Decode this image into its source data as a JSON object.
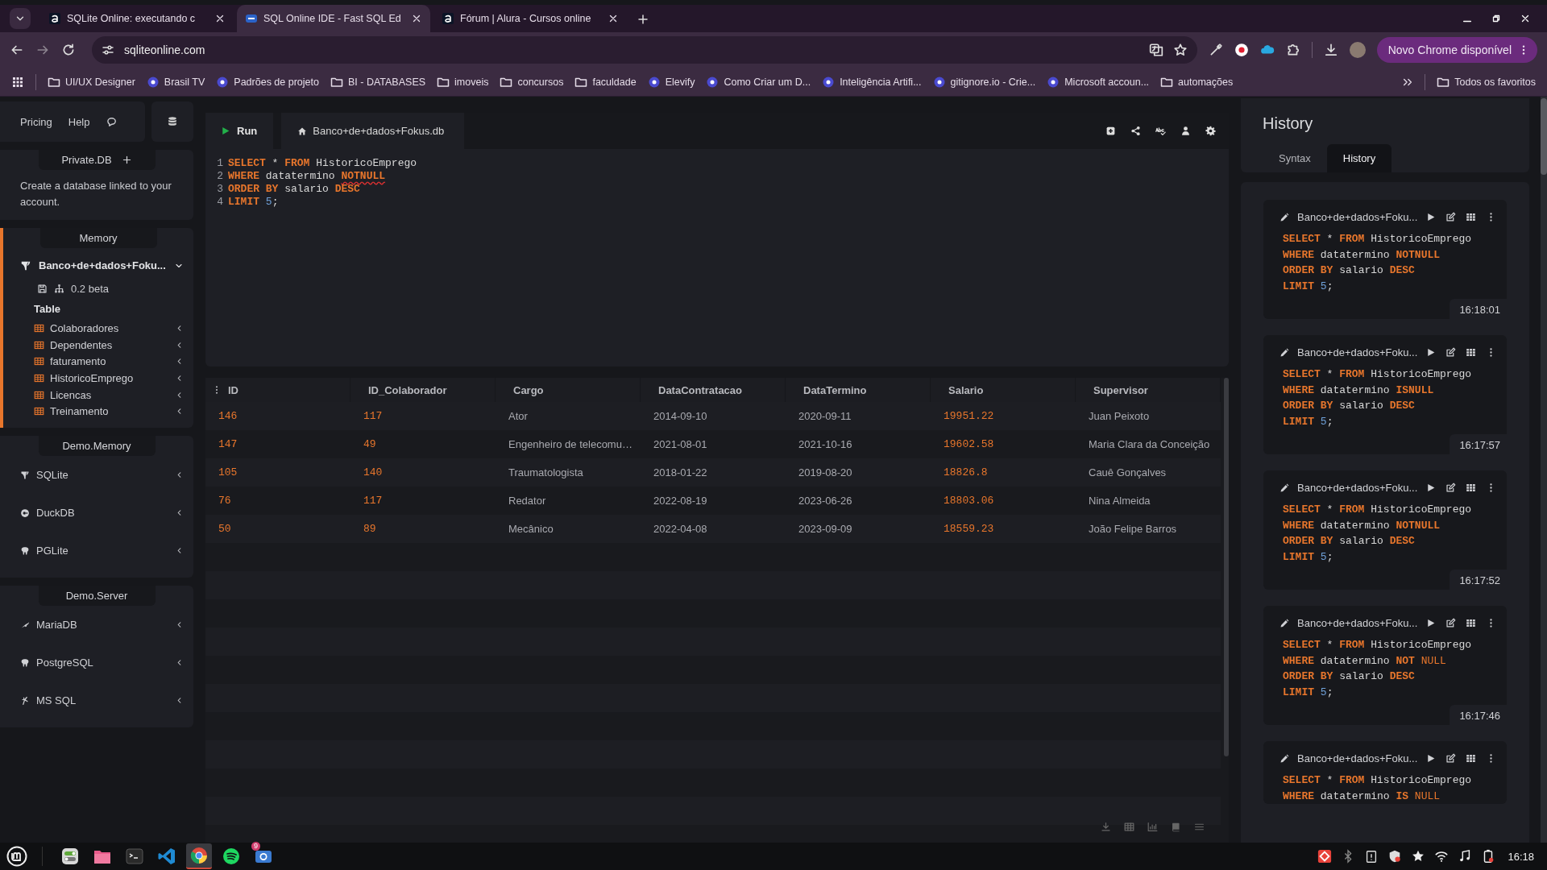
{
  "browser": {
    "tabs": [
      {
        "title": "SQLite Online: executando c",
        "kind": "alura",
        "selected": false
      },
      {
        "title": "SQL Online IDE - Fast SQL Ed",
        "kind": "sql",
        "selected": true
      },
      {
        "title": "Fórum | Alura - Cursos online",
        "kind": "alura",
        "selected": false
      }
    ],
    "address": "sqliteonline.com",
    "update_button": "Novo Chrome disponível",
    "bookmarks": [
      {
        "label": "UI/UX Designer",
        "kind": "folder"
      },
      {
        "label": "Brasil TV",
        "kind": "site"
      },
      {
        "label": "Padrões de projeto",
        "kind": "site"
      },
      {
        "label": "BI - DATABASES",
        "kind": "folder"
      },
      {
        "label": "imoveis",
        "kind": "folder"
      },
      {
        "label": "concursos",
        "kind": "folder"
      },
      {
        "label": "faculdade",
        "kind": "folder"
      },
      {
        "label": "Elevify",
        "kind": "site"
      },
      {
        "label": "Como Criar um D...",
        "kind": "site"
      },
      {
        "label": "Inteligência Artifi...",
        "kind": "site"
      },
      {
        "label": "gitignore.io - Crie...",
        "kind": "site"
      },
      {
        "label": "Microsoft accoun...",
        "kind": "site"
      },
      {
        "label": "automações",
        "kind": "folder"
      }
    ],
    "all_bookmarks": "Todos os favoritos"
  },
  "sidebar": {
    "nav": [
      "Pricing",
      "Help"
    ],
    "private_db": {
      "title": "Private.DB",
      "description": "Create a database linked to your account."
    },
    "memory": {
      "title": "Memory",
      "database": {
        "name": "Banco+de+dados+Foku...",
        "expanded": true,
        "version": "0.2 beta",
        "tables_heading": "Table",
        "tables": [
          "Colaboradores",
          "Dependentes",
          "faturamento",
          "HistoricoEmprego",
          "Licencas",
          "Treinamento"
        ]
      }
    },
    "groups": [
      {
        "title": "Demo.Memory",
        "items": [
          {
            "label": "SQLite",
            "kind": "sqlite"
          },
          {
            "label": "DuckDB",
            "kind": "duck"
          },
          {
            "label": "PGLite",
            "kind": "elephant"
          }
        ]
      },
      {
        "title": "Demo.Server",
        "items": [
          {
            "label": "MariaDB",
            "kind": "dolphin"
          },
          {
            "label": "PostgreSQL",
            "kind": "elephant"
          },
          {
            "label": "MS SQL",
            "kind": "mssql"
          }
        ]
      }
    ]
  },
  "editor": {
    "run_button": "Run",
    "file_tab": "Banco+de+dados+Fokus.db",
    "lines": [
      {
        "number": "1",
        "tokens": [
          {
            "kind": "keyword",
            "text": "SELECT"
          },
          {
            "kind": "plain",
            "text": " * "
          },
          {
            "kind": "keyword",
            "text": "FROM"
          },
          {
            "kind": "plain",
            "text": " HistoricoEmprego"
          }
        ]
      },
      {
        "number": "2",
        "tokens": [
          {
            "kind": "keyword",
            "text": "WHERE"
          },
          {
            "kind": "plain",
            "text": " datatermino "
          },
          {
            "kind": "error",
            "text": "NOTNULL"
          }
        ]
      },
      {
        "number": "3",
        "tokens": [
          {
            "kind": "keyword",
            "text": "ORDER BY"
          },
          {
            "kind": "plain",
            "text": " salario "
          },
          {
            "kind": "keyword",
            "text": "DESC"
          }
        ]
      },
      {
        "number": "4",
        "tokens": [
          {
            "kind": "keyword",
            "text": "LIMIT"
          },
          {
            "kind": "number",
            "text": " 5"
          },
          {
            "kind": "plain",
            "text": ";"
          }
        ]
      }
    ]
  },
  "results": {
    "columns": [
      {
        "label": "ID",
        "kind": "number"
      },
      {
        "label": "ID_Colaborador",
        "kind": "number"
      },
      {
        "label": "Cargo",
        "kind": "text"
      },
      {
        "label": "DataContratacao",
        "kind": "text"
      },
      {
        "label": "DataTermino",
        "kind": "text"
      },
      {
        "label": "Salario",
        "kind": "number"
      },
      {
        "label": "Supervisor",
        "kind": "text"
      }
    ],
    "rows": [
      [
        "146",
        "117",
        "Ator",
        "2014-09-10",
        "2020-09-11",
        "19951.22",
        "Juan Peixoto"
      ],
      [
        "147",
        "49",
        "Engenheiro de telecomu…",
        "2021-08-01",
        "2021-10-16",
        "19602.58",
        "Maria Clara da Conceição"
      ],
      [
        "105",
        "140",
        "Traumatologista",
        "2018-01-22",
        "2019-08-20",
        "18826.8",
        "Cauê Gonçalves"
      ],
      [
        "76",
        "117",
        "Redator",
        "2022-08-19",
        "2023-06-26",
        "18803.06",
        "Nina Almeida"
      ],
      [
        "50",
        "89",
        "Mecânico",
        "2022-04-08",
        "2023-09-09",
        "18559.23",
        "João Felipe Barros"
      ]
    ]
  },
  "history": {
    "title": "History",
    "tabs": [
      {
        "label": "Syntax",
        "selected": false
      },
      {
        "label": "History",
        "selected": true
      }
    ],
    "entries": [
      {
        "database": "Banco+de+dados+Foku...",
        "time": "16:18:01",
        "lines": [
          [
            {
              "kind": "keyword",
              "text": "SELECT"
            },
            {
              "kind": "plain",
              "text": " * "
            },
            {
              "kind": "keyword",
              "text": "FROM"
            },
            {
              "kind": "plain",
              "text": " HistoricoEmprego"
            }
          ],
          [
            {
              "kind": "keyword",
              "text": "WHERE"
            },
            {
              "kind": "plain",
              "text": " datatermino "
            },
            {
              "kind": "keyword",
              "text": "NOTNULL"
            }
          ],
          [
            {
              "kind": "keyword",
              "text": "ORDER BY"
            },
            {
              "kind": "plain",
              "text": " salario "
            },
            {
              "kind": "keyword",
              "text": "DESC"
            }
          ],
          [
            {
              "kind": "keyword",
              "text": "LIMIT"
            },
            {
              "kind": "number",
              "text": " 5"
            },
            {
              "kind": "plain",
              "text": ";"
            }
          ]
        ]
      },
      {
        "database": "Banco+de+dados+Foku...",
        "time": "16:17:57",
        "lines": [
          [
            {
              "kind": "keyword",
              "text": "SELECT"
            },
            {
              "kind": "plain",
              "text": " * "
            },
            {
              "kind": "keyword",
              "text": "FROM"
            },
            {
              "kind": "plain",
              "text": " HistoricoEmprego"
            }
          ],
          [
            {
              "kind": "keyword",
              "text": "WHERE"
            },
            {
              "kind": "plain",
              "text": " datatermino "
            },
            {
              "kind": "keyword",
              "text": "ISNULL"
            }
          ],
          [
            {
              "kind": "keyword",
              "text": "ORDER BY"
            },
            {
              "kind": "plain",
              "text": " salario "
            },
            {
              "kind": "keyword",
              "text": "DESC"
            }
          ],
          [
            {
              "kind": "keyword",
              "text": "LIMIT"
            },
            {
              "kind": "number",
              "text": " 5"
            },
            {
              "kind": "plain",
              "text": ";"
            }
          ]
        ]
      },
      {
        "database": "Banco+de+dados+Foku...",
        "time": "16:17:52",
        "lines": [
          [
            {
              "kind": "keyword",
              "text": "SELECT"
            },
            {
              "kind": "plain",
              "text": " * "
            },
            {
              "kind": "keyword",
              "text": "FROM"
            },
            {
              "kind": "plain",
              "text": " HistoricoEmprego"
            }
          ],
          [
            {
              "kind": "keyword",
              "text": "WHERE"
            },
            {
              "kind": "plain",
              "text": " datatermino "
            },
            {
              "kind": "keyword",
              "text": "NOTNULL"
            }
          ],
          [
            {
              "kind": "keyword",
              "text": "ORDER BY"
            },
            {
              "kind": "plain",
              "text": " salario "
            },
            {
              "kind": "keyword",
              "text": "DESC"
            }
          ],
          [
            {
              "kind": "keyword",
              "text": "LIMIT"
            },
            {
              "kind": "number",
              "text": " 5"
            },
            {
              "kind": "plain",
              "text": ";"
            }
          ]
        ]
      },
      {
        "database": "Banco+de+dados+Foku...",
        "time": "16:17:46",
        "lines": [
          [
            {
              "kind": "keyword",
              "text": "SELECT"
            },
            {
              "kind": "plain",
              "text": " * "
            },
            {
              "kind": "keyword",
              "text": "FROM"
            },
            {
              "kind": "plain",
              "text": " HistoricoEmprego"
            }
          ],
          [
            {
              "kind": "keyword",
              "text": "WHERE"
            },
            {
              "kind": "plain",
              "text": " datatermino "
            },
            {
              "kind": "keyword",
              "text": "NOT"
            },
            {
              "kind": "literal",
              "text": " NULL"
            }
          ],
          [
            {
              "kind": "keyword",
              "text": "ORDER BY"
            },
            {
              "kind": "plain",
              "text": " salario "
            },
            {
              "kind": "keyword",
              "text": "DESC"
            }
          ],
          [
            {
              "kind": "keyword",
              "text": "LIMIT"
            },
            {
              "kind": "number",
              "text": " 5"
            },
            {
              "kind": "plain",
              "text": ";"
            }
          ]
        ]
      },
      {
        "database": "Banco+de+dados+Foku...",
        "lines": [
          [
            {
              "kind": "keyword",
              "text": "SELECT"
            },
            {
              "kind": "plain",
              "text": " * "
            },
            {
              "kind": "keyword",
              "text": "FROM"
            },
            {
              "kind": "plain",
              "text": " HistoricoEmprego"
            }
          ],
          [
            {
              "kind": "keyword",
              "text": "WHERE"
            },
            {
              "kind": "plain",
              "text": " datatermino "
            },
            {
              "kind": "keyword",
              "text": "IS"
            },
            {
              "kind": "literal",
              "text": " NULL"
            }
          ]
        ]
      }
    ]
  },
  "taskbar": {
    "apps": [
      {
        "selected": false
      },
      {
        "selected": false
      },
      {
        "selected": false
      },
      {
        "selected": false
      },
      {
        "selected": true
      },
      {
        "selected": false
      },
      {
        "selected": false,
        "badge": "9"
      }
    ],
    "clock": "16:18"
  }
}
